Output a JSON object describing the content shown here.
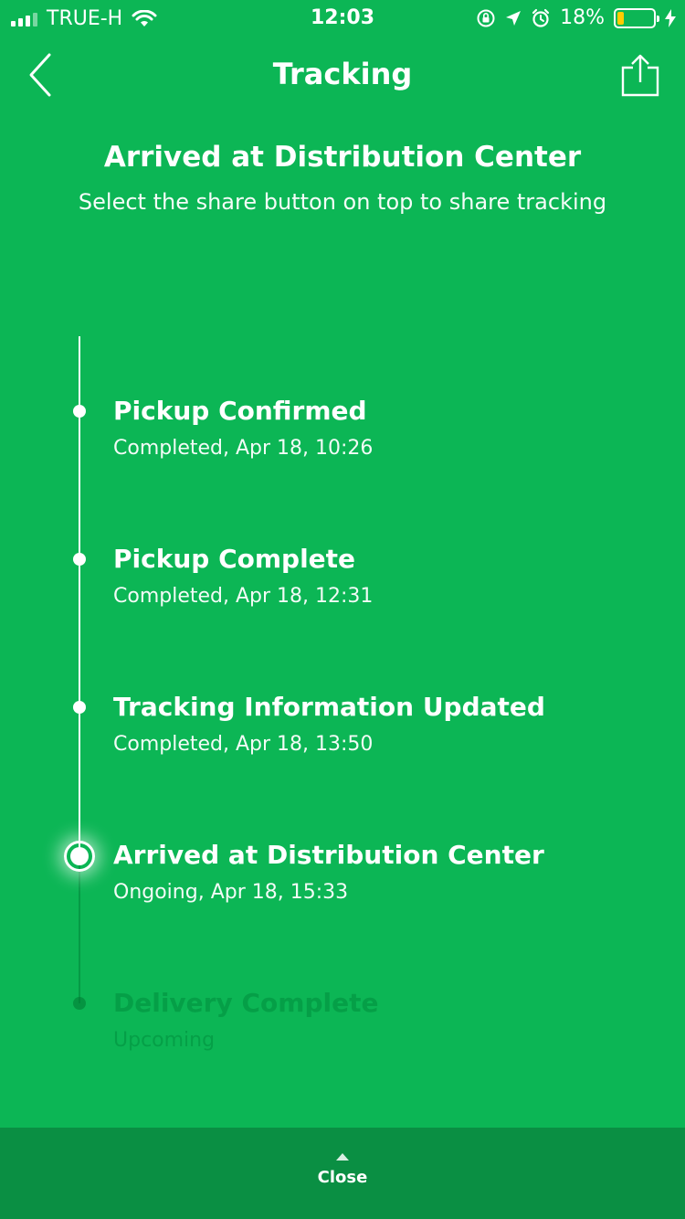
{
  "status_bar": {
    "carrier": "TRUE-H",
    "time": "12:03",
    "battery": "18%",
    "battery_level": 0.18,
    "battery_color": "#ffcc00",
    "icons": [
      "signal-icon",
      "wifi-icon",
      "orientation-lock-icon",
      "location-icon",
      "alarm-icon",
      "battery-icon",
      "charging-icon"
    ]
  },
  "nav": {
    "title": "Tracking",
    "back_icon": "chevron-left-icon",
    "share_icon": "share-icon"
  },
  "header": {
    "headline": "Arrived at Distribution Center",
    "subline": "Select the share button on top to share tracking"
  },
  "timeline": {
    "steps": [
      {
        "title": "Pickup Confirmed",
        "status": "Completed, Apr 18, 10:26",
        "state": "completed"
      },
      {
        "title": "Pickup Complete",
        "status": "Completed, Apr 18, 12:31",
        "state": "completed"
      },
      {
        "title": "Tracking Information Updated",
        "status": "Completed, Apr 18, 13:50",
        "state": "completed"
      },
      {
        "title": "Arrived at Distribution Center",
        "status": "Ongoing, Apr 18, 15:33",
        "state": "ongoing"
      },
      {
        "title": "Delivery Complete",
        "status": "Upcoming",
        "state": "upcoming"
      }
    ]
  },
  "footer": {
    "close_label": "Close",
    "close_icon": "chevron-up-icon"
  },
  "colors": {
    "background": "#0cb655",
    "footer": "#0a8f43",
    "text": "#ffffff"
  }
}
